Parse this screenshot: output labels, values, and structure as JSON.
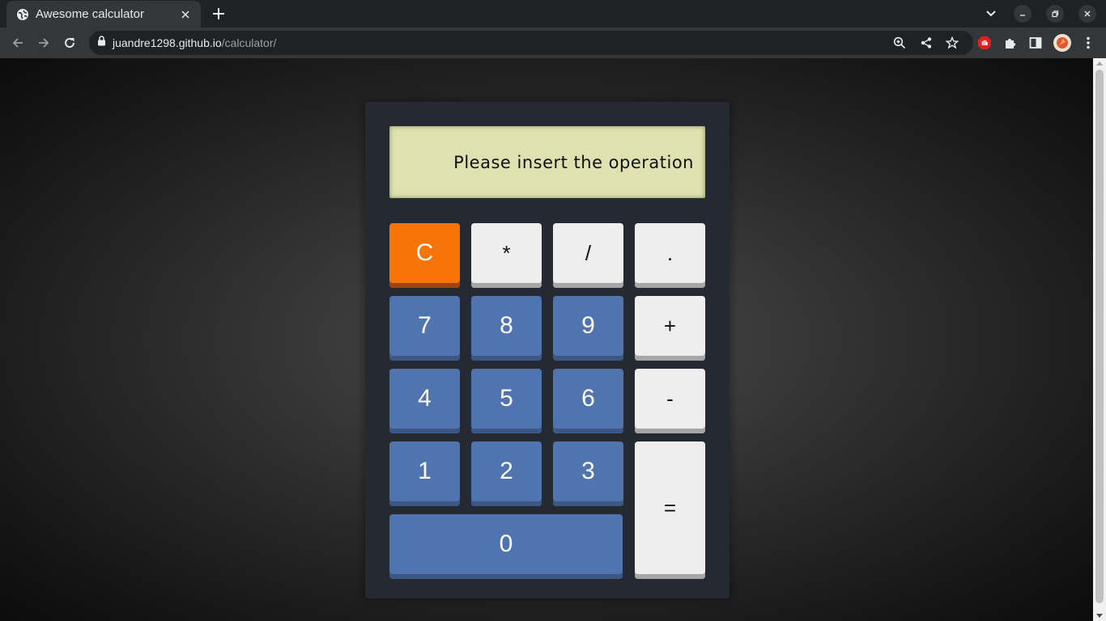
{
  "browser": {
    "tab_title": "Awesome calculator",
    "url_host": "juandre1298.github.io",
    "url_path": "/calculator/"
  },
  "calculator": {
    "display": "Please insert the operation",
    "keys": {
      "clear": "C",
      "multiply": "*",
      "divide": "/",
      "decimal": ".",
      "seven": "7",
      "eight": "8",
      "nine": "9",
      "plus": "+",
      "four": "4",
      "five": "5",
      "six": "6",
      "minus": "-",
      "one": "1",
      "two": "2",
      "three": "3",
      "equals": "=",
      "zero": "0"
    }
  },
  "colors": {
    "clear_key": "#f77408",
    "number_key": "#5074b0",
    "operator_key": "#eeeeee",
    "display_bg": "#dfe1b0",
    "calculator_body": "#252932"
  },
  "icons": [
    "globe-icon",
    "close-icon",
    "plus-icon",
    "chevron-down-icon",
    "minimize-icon",
    "restore-icon",
    "back-icon",
    "forward-icon",
    "reload-icon",
    "lock-icon",
    "zoom-icon",
    "share-icon",
    "star-icon",
    "extension-shield-icon",
    "puzzle-icon",
    "side-panel-icon",
    "profile-avatar",
    "kebab-menu-icon"
  ]
}
